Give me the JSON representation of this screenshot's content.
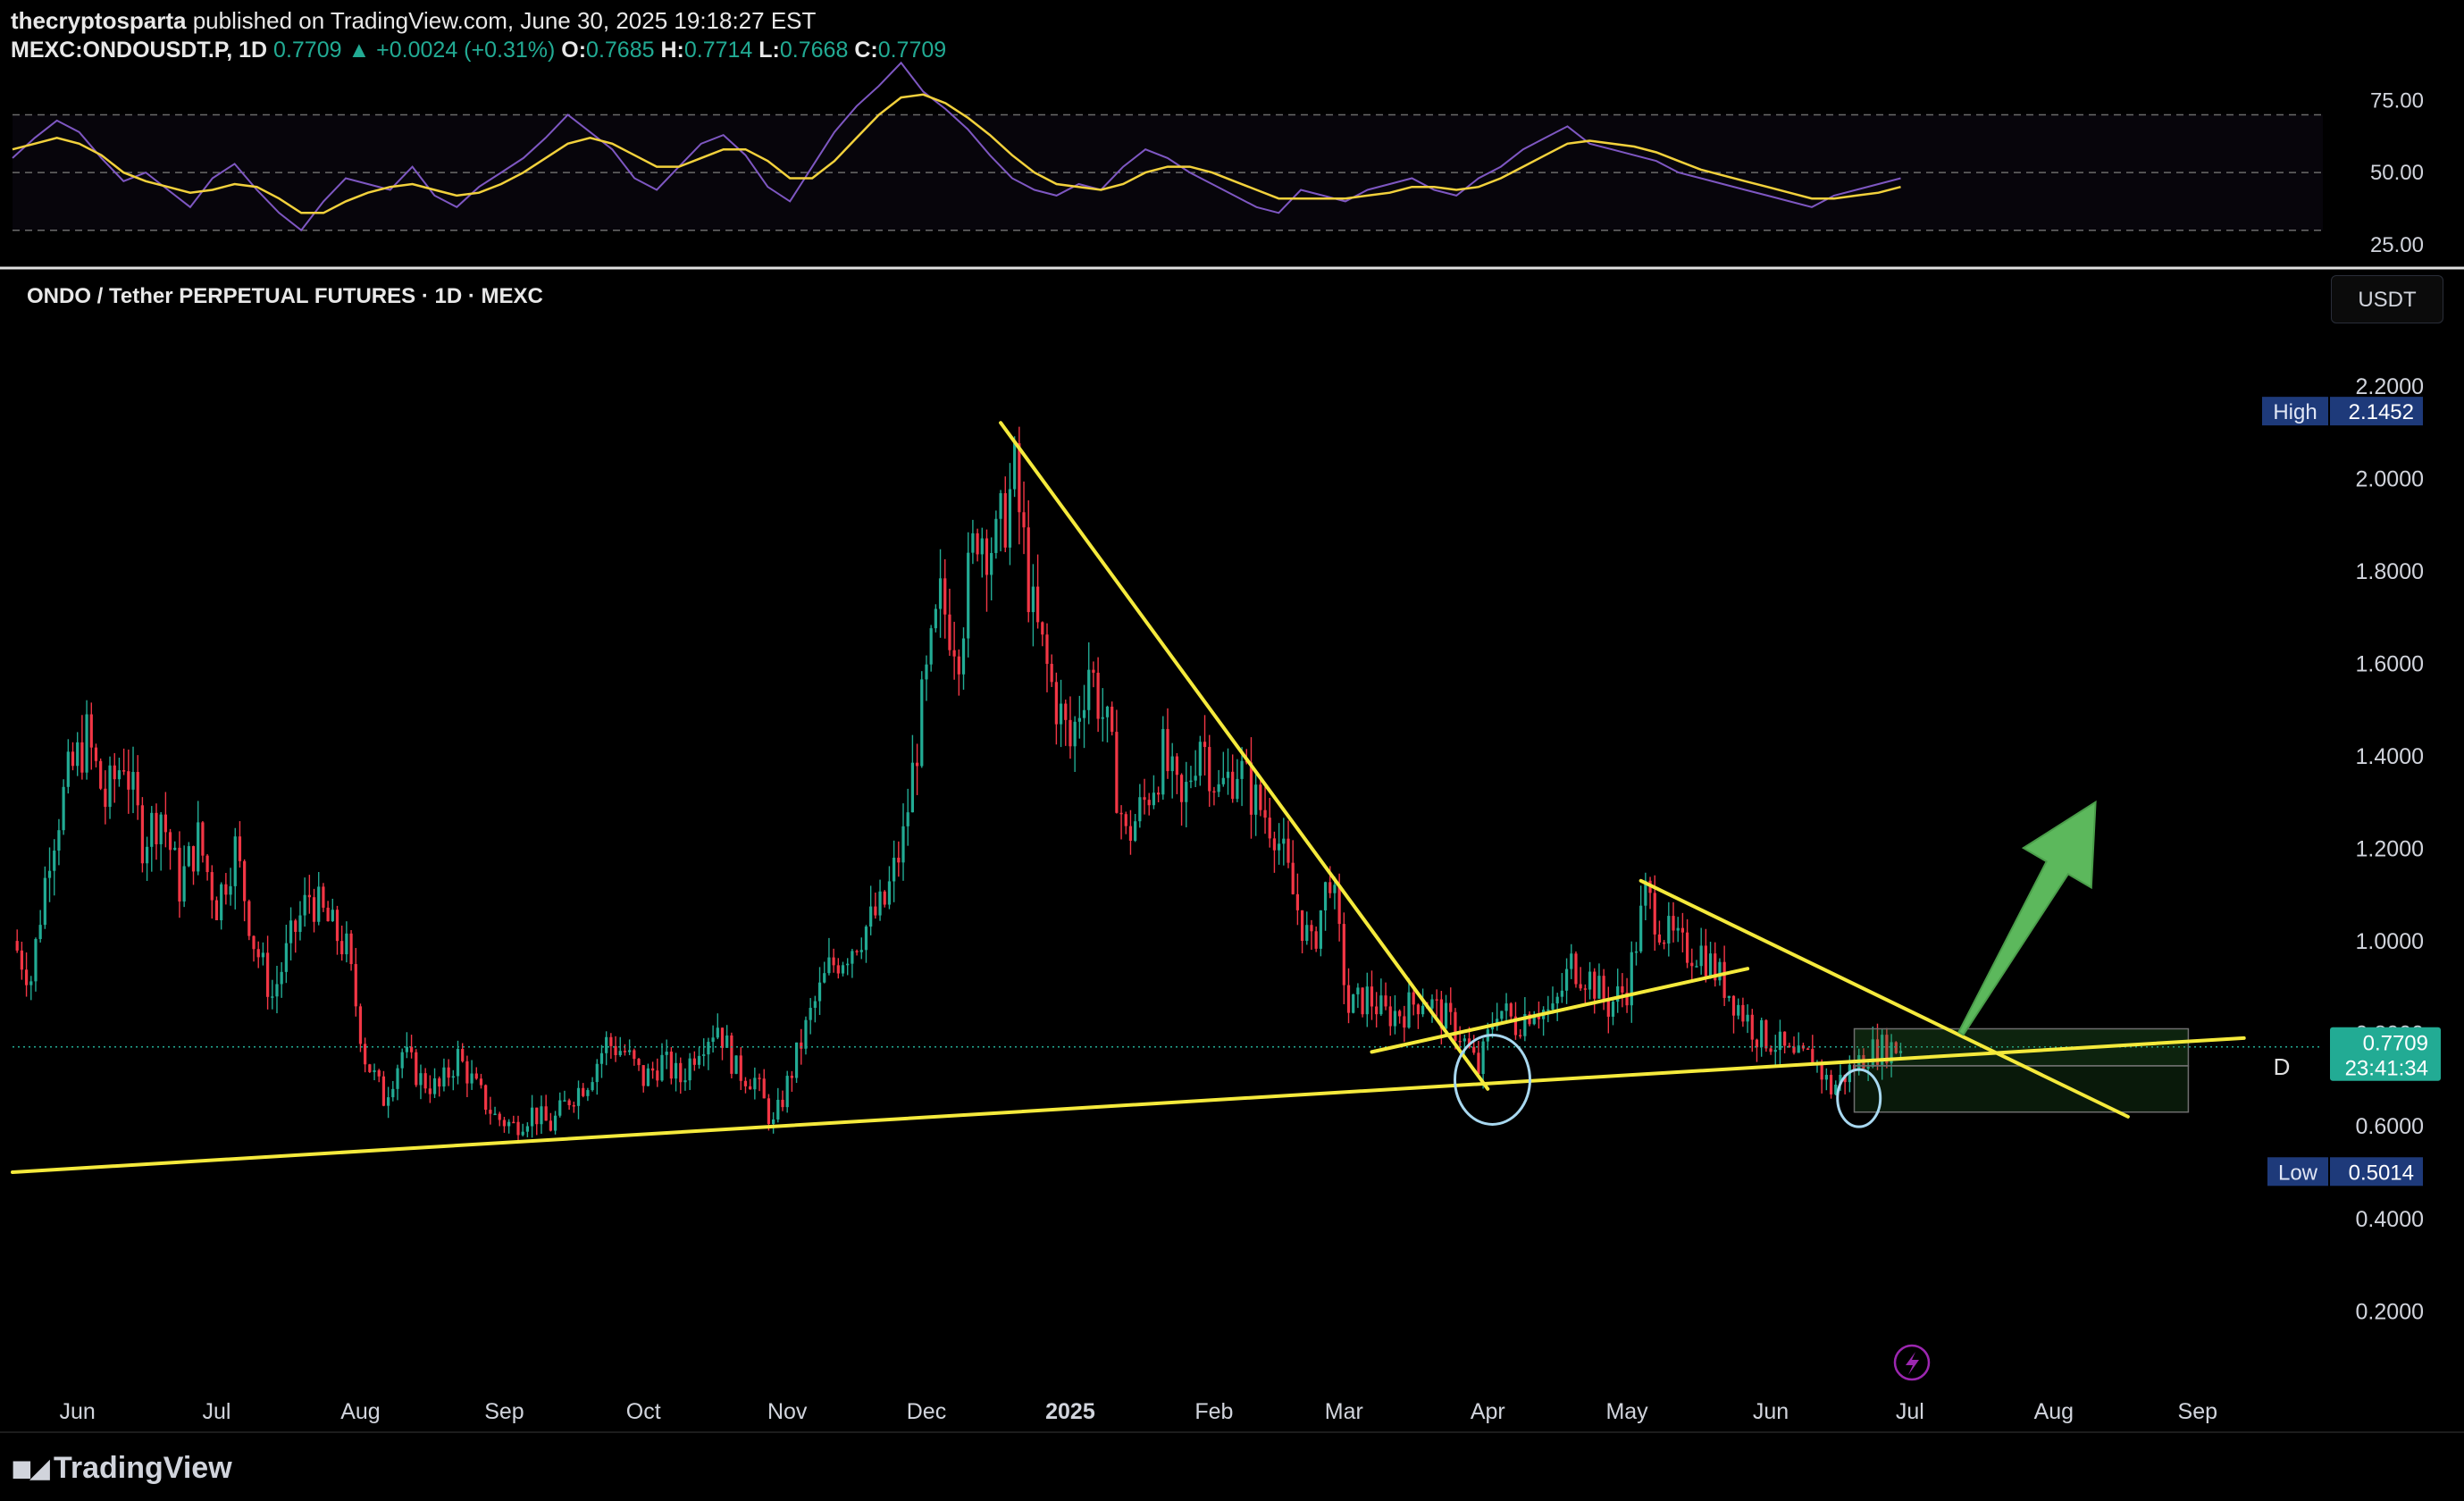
{
  "header": {
    "author": "thecryptosparta",
    "published_text": " published on TradingView.com, June 30, 2025 19:18:27 EST",
    "symbol": "MEXC:ONDOUSDT.P, 1D",
    "last": "0.7709",
    "change": "▲ +0.0024 (+0.31%)",
    "o_label": "O:",
    "o": "0.7685",
    "h_label": "H:",
    "h": "0.7714",
    "l_label": "L:",
    "l": "0.7668",
    "c_label": "C:",
    "c": "0.7709"
  },
  "panel_title": "ONDO / Tether PERPETUAL FUTURES · 1D · MEXC",
  "currency_button": "USDT",
  "brand": "TradingView",
  "colors": {
    "up": "#22ab94",
    "down": "#f23645",
    "rsi": "#7e57c2",
    "rsi_ma": "#f2d13c",
    "trendline": "#f5ea3c",
    "arrow": "#5cb85c",
    "annotation": "#a8d8f0"
  },
  "chart_data": [
    {
      "type": "line",
      "title": "",
      "y_ticks": [
        "75.00",
        "50.00",
        "25.00"
      ],
      "levels": [
        70,
        50,
        30
      ],
      "ylim": [
        20,
        85
      ],
      "series": [
        {
          "name": "",
          "values": [
            55,
            62,
            68,
            64,
            55,
            47,
            50,
            44,
            38,
            48,
            53,
            44,
            36,
            30,
            40,
            48,
            46,
            44,
            52,
            42,
            38,
            45,
            50,
            55,
            62,
            70,
            64,
            58,
            48,
            44,
            52,
            60,
            63,
            56,
            45,
            40,
            52,
            64,
            73,
            80,
            88,
            78,
            72,
            65,
            56,
            48,
            44,
            42,
            46,
            44,
            52,
            58,
            55,
            50,
            46,
            42,
            38,
            36,
            44,
            42,
            40,
            44,
            46,
            48,
            44,
            42,
            48,
            52,
            58,
            62,
            66,
            60,
            58,
            56,
            54,
            50,
            48,
            46,
            44,
            42,
            40,
            38,
            42,
            44,
            46,
            48
          ]
        },
        {
          "name": "",
          "values": [
            58,
            60,
            62,
            60,
            56,
            50,
            47,
            45,
            43,
            44,
            46,
            45,
            41,
            36,
            36,
            40,
            43,
            45,
            46,
            44,
            42,
            43,
            46,
            50,
            55,
            60,
            62,
            60,
            56,
            52,
            52,
            55,
            58,
            58,
            54,
            48,
            48,
            54,
            62,
            70,
            76,
            77,
            74,
            69,
            63,
            56,
            50,
            46,
            45,
            44,
            46,
            50,
            52,
            52,
            50,
            47,
            44,
            41,
            41,
            41,
            41,
            42,
            43,
            45,
            45,
            44,
            45,
            48,
            52,
            56,
            60,
            61,
            60,
            59,
            57,
            54,
            51,
            49,
            47,
            45,
            43,
            41,
            41,
            42,
            43,
            45
          ]
        }
      ]
    },
    {
      "type": "candlestick",
      "title": "",
      "y_ticks": [
        "2.2000",
        "2.0000",
        "1.8000",
        "1.6000",
        "1.4000",
        "1.2000",
        "1.0000",
        "0.8000",
        "0.6000",
        "0.4000",
        "0.2000"
      ],
      "ylim": [
        0.05,
        2.3
      ],
      "x_ticks": [
        {
          "label": "Jun",
          "day": 0
        },
        {
          "label": "Jul",
          "day": 30
        },
        {
          "label": "Aug",
          "day": 61
        },
        {
          "label": "Sep",
          "day": 92
        },
        {
          "label": "Oct",
          "day": 122
        },
        {
          "label": "Nov",
          "day": 153
        },
        {
          "label": "Dec",
          "day": 183
        },
        {
          "label": "2025",
          "day": 214,
          "bold": true
        },
        {
          "label": "Feb",
          "day": 245
        },
        {
          "label": "Mar",
          "day": 273
        },
        {
          "label": "Apr",
          "day": 304
        },
        {
          "label": "May",
          "day": 334
        },
        {
          "label": "Jun",
          "day": 365
        },
        {
          "label": "Jul",
          "day": 395
        },
        {
          "label": "Aug",
          "day": 426
        },
        {
          "label": "Sep",
          "day": 457
        }
      ],
      "x_range": [
        -14,
        484
      ],
      "close_path": [
        [
          -14,
          1.0
        ],
        [
          -10,
          0.92
        ],
        [
          -6,
          1.2
        ],
        [
          -2,
          1.35
        ],
        [
          2,
          1.44
        ],
        [
          6,
          1.3
        ],
        [
          10,
          1.4
        ],
        [
          14,
          1.22
        ],
        [
          18,
          1.28
        ],
        [
          22,
          1.12
        ],
        [
          26,
          1.22
        ],
        [
          30,
          1.08
        ],
        [
          34,
          1.2
        ],
        [
          38,
          1.0
        ],
        [
          42,
          0.88
        ],
        [
          46,
          1.0
        ],
        [
          50,
          1.1
        ],
        [
          54,
          1.04
        ],
        [
          58,
          0.98
        ],
        [
          62,
          0.75
        ],
        [
          66,
          0.66
        ],
        [
          70,
          0.76
        ],
        [
          74,
          0.7
        ],
        [
          78,
          0.68
        ],
        [
          82,
          0.75
        ],
        [
          86,
          0.68
        ],
        [
          90,
          0.62
        ],
        [
          94,
          0.6
        ],
        [
          98,
          0.63
        ],
        [
          102,
          0.6
        ],
        [
          106,
          0.66
        ],
        [
          110,
          0.7
        ],
        [
          114,
          0.78
        ],
        [
          118,
          0.76
        ],
        [
          122,
          0.7
        ],
        [
          126,
          0.74
        ],
        [
          130,
          0.7
        ],
        [
          134,
          0.78
        ],
        [
          138,
          0.82
        ],
        [
          142,
          0.72
        ],
        [
          146,
          0.7
        ],
        [
          150,
          0.6
        ],
        [
          154,
          0.72
        ],
        [
          158,
          0.84
        ],
        [
          162,
          0.94
        ],
        [
          166,
          0.98
        ],
        [
          170,
          1.03
        ],
        [
          174,
          1.08
        ],
        [
          178,
          1.22
        ],
        [
          182,
          1.5
        ],
        [
          186,
          1.73
        ],
        [
          190,
          1.65
        ],
        [
          194,
          1.9
        ],
        [
          198,
          1.85
        ],
        [
          202,
          2.0
        ],
        [
          206,
          1.7
        ],
        [
          210,
          1.55
        ],
        [
          214,
          1.42
        ],
        [
          218,
          1.6
        ],
        [
          222,
          1.45
        ],
        [
          226,
          1.22
        ],
        [
          230,
          1.3
        ],
        [
          234,
          1.4
        ],
        [
          238,
          1.28
        ],
        [
          242,
          1.45
        ],
        [
          246,
          1.32
        ],
        [
          250,
          1.38
        ],
        [
          254,
          1.3
        ],
        [
          258,
          1.25
        ],
        [
          262,
          1.1
        ],
        [
          266,
          0.98
        ],
        [
          270,
          1.15
        ],
        [
          274,
          0.85
        ],
        [
          278,
          0.88
        ],
        [
          282,
          0.84
        ],
        [
          286,
          0.85
        ],
        [
          290,
          0.88
        ],
        [
          294,
          0.84
        ],
        [
          298,
          0.8
        ],
        [
          302,
          0.72
        ],
        [
          306,
          0.86
        ],
        [
          310,
          0.82
        ],
        [
          314,
          0.86
        ],
        [
          318,
          0.84
        ],
        [
          322,
          0.95
        ],
        [
          326,
          0.92
        ],
        [
          330,
          0.86
        ],
        [
          334,
          0.9
        ],
        [
          338,
          1.1
        ],
        [
          342,
          1.02
        ],
        [
          346,
          0.98
        ],
        [
          350,
          0.98
        ],
        [
          354,
          0.92
        ],
        [
          358,
          0.86
        ],
        [
          362,
          0.8
        ],
        [
          366,
          0.78
        ],
        [
          370,
          0.74
        ],
        [
          374,
          0.75
        ],
        [
          378,
          0.68
        ],
        [
          382,
          0.72
        ],
        [
          386,
          0.76
        ],
        [
          390,
          0.77
        ],
        [
          393,
          0.7709
        ]
      ],
      "high": {
        "label": "High",
        "value": "2.1452"
      },
      "low": {
        "label": "Low",
        "value": "0.5014"
      },
      "last": {
        "value": "0.7709",
        "countdown": "23:41:34"
      },
      "interval_marker": "D",
      "trendlines": [
        {
          "p1": [
            -14,
            0.5
          ],
          "p2": [
            467,
            0.79
          ]
        },
        {
          "p1": [
            199,
            2.12
          ],
          "p2": [
            304,
            0.68
          ]
        },
        {
          "p1": [
            279,
            0.76
          ],
          "p2": [
            360,
            0.94
          ]
        },
        {
          "p1": [
            337,
            1.13
          ],
          "p2": [
            442,
            0.62
          ]
        }
      ],
      "zone": {
        "day_start": 383,
        "day_end": 455,
        "price_top": 0.81,
        "price_mid": 0.73,
        "price_bottom": 0.63
      },
      "arrow": {
        "from": [
          406,
          0.8
        ],
        "to": [
          435,
          1.3
        ]
      },
      "circles": [
        {
          "day": 305,
          "price": 0.7
        },
        {
          "day": 384,
          "price": 0.66
        }
      ]
    }
  ]
}
